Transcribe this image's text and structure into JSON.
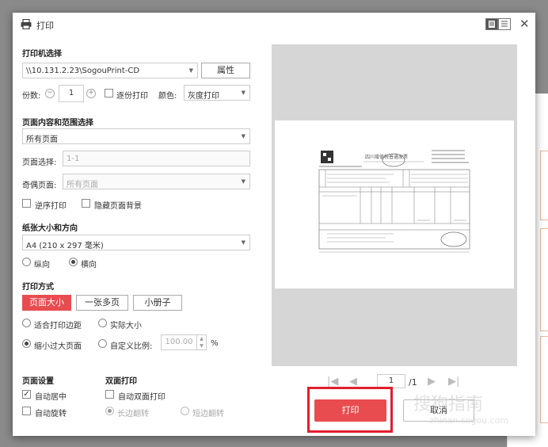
{
  "dialog": {
    "title": "打印"
  },
  "printer": {
    "section_title": "打印机选择",
    "selected": "\\\\10.131.2.23\\SogouPrint-CD",
    "properties_label": "属性",
    "copies_label": "份数:",
    "copies_value": "1",
    "collate_label": "逐份打印",
    "color_label": "颜色:",
    "color_value": "灰度打印"
  },
  "range": {
    "section_title": "页面内容和范围选择",
    "content_value": "所有页面",
    "page_select_label": "页面选择:",
    "page_select_placeholder": "1-1",
    "odd_even_label": "奇偶页面:",
    "odd_even_value": "所有页面",
    "reverse_label": "逆序打印",
    "hide_bg_label": "隐藏页面背景"
  },
  "paper": {
    "section_title": "纸张大小和方向",
    "size_value": "A4 (210 x 297 毫米)",
    "portrait_label": "纵向",
    "landscape_label": "横向"
  },
  "mode": {
    "section_title": "打印方式",
    "tabs": [
      "页面大小",
      "一张多页",
      "小册子"
    ],
    "fit_margin_label": "适合打印边距",
    "actual_size_label": "实际大小",
    "shrink_label": "缩小过大页面",
    "custom_scale_label": "自定义比例:",
    "scale_value": "100.00",
    "percent": "%"
  },
  "page_setup": {
    "section_title": "页面设置",
    "auto_center_label": "自动居中",
    "auto_rotate_label": "自动旋转"
  },
  "duplex": {
    "section_title": "双面打印",
    "auto_duplex_label": "自动双面打印",
    "long_edge_label": "长边翻转",
    "short_edge_label": "短边翻转"
  },
  "preview": {
    "invoice_title": "四川增值税普通发票",
    "current_page": "1",
    "total_pages": "/1"
  },
  "actions": {
    "print_label": "打印",
    "cancel_label": "取消"
  },
  "watermark": {
    "text": "搜狗指南",
    "sub": "zhinan.sogou.com"
  },
  "colors": {
    "accent": "#e84c4f",
    "highlight": "#e21d2c"
  }
}
